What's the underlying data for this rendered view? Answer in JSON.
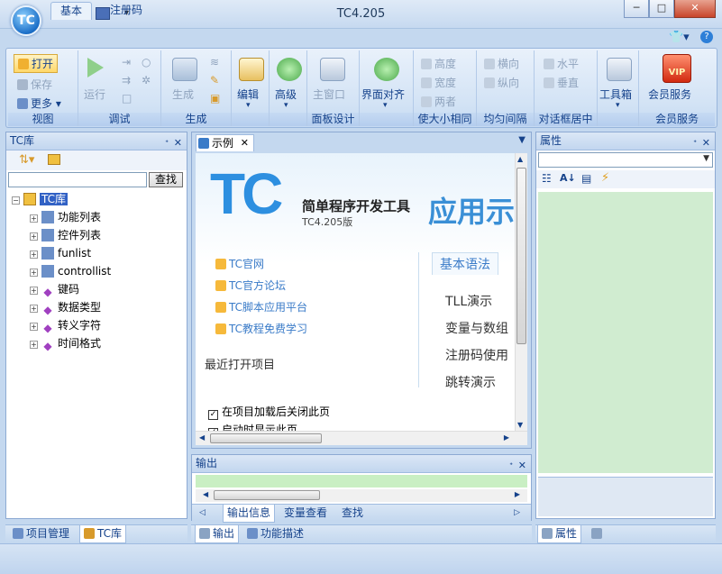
{
  "window": {
    "title": "TC4.205",
    "orb_label": "TC"
  },
  "ribbon": {
    "tabs": [
      "基本",
      "注册码"
    ],
    "groups": {
      "view": {
        "caption": "视图",
        "open": "打开",
        "save": "保存",
        "more": "更多"
      },
      "debug": {
        "caption": "调试",
        "run": "运行"
      },
      "generate": {
        "caption": "生成",
        "build": "生成"
      },
      "edit": {
        "label": "编辑"
      },
      "advanced": {
        "label": "高级"
      },
      "panel_design": {
        "caption": "面板设计",
        "main_window": "主窗口"
      },
      "ui_align": {
        "label": "界面对齐"
      },
      "same_size": {
        "caption": "使大小相同",
        "height": "高度",
        "width": "宽度",
        "both": "两者"
      },
      "spacing": {
        "caption": "均匀间隔",
        "horizontal": "横向",
        "vertical": "纵向"
      },
      "center": {
        "caption": "对话框居中",
        "horizontal": "水平",
        "vertical": "垂直"
      },
      "toolbox": {
        "label": "工具箱"
      },
      "vip": {
        "caption": "会员服务",
        "label": "会员服务",
        "badge": "VIP"
      }
    }
  },
  "left_panel": {
    "title": "TC库",
    "search_button": "查找",
    "search_value": "",
    "tree": {
      "root": "TC库",
      "items": [
        "功能列表",
        "控件列表",
        "funlist",
        "controllist",
        "键码",
        "数据类型",
        "转义字符",
        "时间格式"
      ]
    },
    "bottom_tabs": [
      "项目管理",
      "TC库"
    ]
  },
  "editor": {
    "tab": "示例",
    "start_page": {
      "logo": "TC",
      "product_name": "简单程序开发工具",
      "version": "TC4.205版",
      "banner": "应用示",
      "links": [
        "TC官网",
        "TC官方论坛",
        "TC脚本应用平台",
        "TC教程免费学习"
      ],
      "recent_title": "最近打开项目",
      "syntax_tab": "基本语法",
      "syntax_items": [
        "TLL演示",
        "变量与数组",
        "注册码使用",
        "跳转演示"
      ],
      "checkboxes": [
        "在项目加载后关闭此页",
        "启动时显示此页"
      ]
    }
  },
  "output_panel": {
    "title": "输出",
    "tabs": [
      "输出信息",
      "变量查看",
      "查找"
    ]
  },
  "bottom_doc_tabs": [
    "输出",
    "功能描述"
  ],
  "right_panel": {
    "title": "属性",
    "bottom_tabs": [
      "属性"
    ]
  },
  "colors": {
    "accent": "#15428b",
    "ribbon_bg": "#d3e3f5",
    "output_green": "#c9efc3",
    "props_green": "#d0ecd0"
  }
}
